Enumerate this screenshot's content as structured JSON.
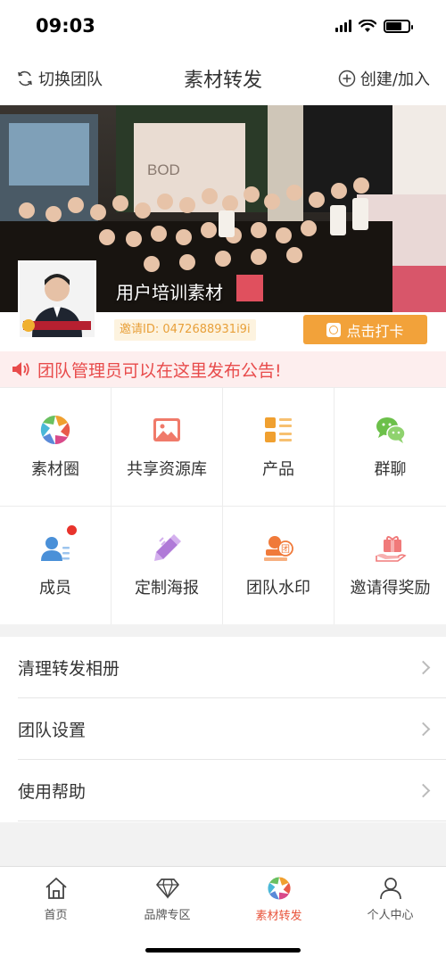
{
  "status_bar": {
    "time": "09:03"
  },
  "nav": {
    "left_label": "切换团队",
    "title": "素材转发",
    "right_label": "创建/加入"
  },
  "hero": {
    "team_name": "用户培训素材",
    "invite_id": "邀请ID: 0472688931i9i",
    "checkin_label": "点击打卡"
  },
  "notice": {
    "text": "团队管理员可以在这里发布公告!"
  },
  "grid": [
    {
      "label": "素材圈",
      "icon": "aperture-icon"
    },
    {
      "label": "共享资源库",
      "icon": "image-icon"
    },
    {
      "label": "产品",
      "icon": "list-icon"
    },
    {
      "label": "群聊",
      "icon": "chat-icon"
    },
    {
      "label": "成员",
      "icon": "member-icon"
    },
    {
      "label": "定制海报",
      "icon": "poster-icon"
    },
    {
      "label": "团队水印",
      "icon": "stamp-icon"
    },
    {
      "label": "邀请得奖励",
      "icon": "gift-icon"
    }
  ],
  "menu": [
    {
      "label": "清理转发相册"
    },
    {
      "label": "团队设置"
    },
    {
      "label": "使用帮助"
    }
  ],
  "tabs": [
    {
      "label": "首页",
      "icon": "home-icon"
    },
    {
      "label": "品牌专区",
      "icon": "diamond-icon"
    },
    {
      "label": "素材转发",
      "icon": "aperture-icon"
    },
    {
      "label": "个人中心",
      "icon": "person-icon"
    }
  ],
  "colors": {
    "accent": "#e8533a",
    "checkin": "#f2a23a",
    "notice": "#e84b4b"
  }
}
